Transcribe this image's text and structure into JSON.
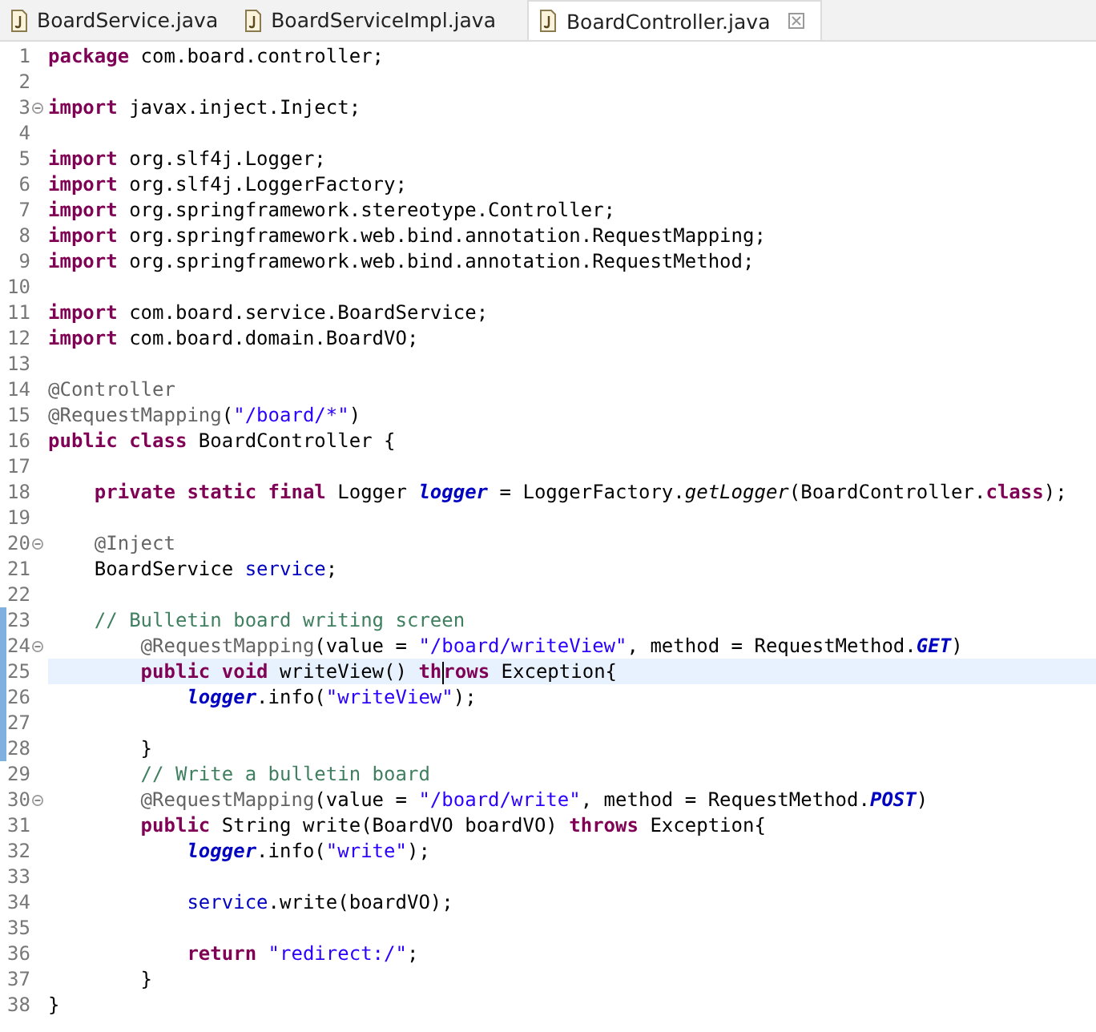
{
  "tabs": [
    {
      "label": "BoardService.java",
      "selected": false,
      "closable": false
    },
    {
      "label": "BoardServiceImpl.java",
      "selected": false,
      "closable": false
    },
    {
      "label": "BoardController.java",
      "selected": true,
      "closable": true
    }
  ],
  "editor": {
    "lines": [
      {
        "number": "1",
        "fold": false,
        "changed": false,
        "current": false,
        "tokens": [
          {
            "kind": "kw",
            "text": "package"
          },
          {
            "kind": "plain",
            "text": " com.board.controller;"
          }
        ]
      },
      {
        "number": "2",
        "fold": false,
        "changed": false,
        "current": false
      },
      {
        "number": "3",
        "fold": true,
        "changed": false,
        "current": false,
        "tokens": [
          {
            "kind": "kw",
            "text": "import"
          },
          {
            "kind": "plain",
            "text": " javax.inject.Inject;"
          }
        ]
      },
      {
        "number": "4",
        "fold": false,
        "changed": false,
        "current": false
      },
      {
        "number": "5",
        "fold": false,
        "changed": false,
        "current": false,
        "tokens": [
          {
            "kind": "kw",
            "text": "import"
          },
          {
            "kind": "plain",
            "text": " org.slf4j.Logger;"
          }
        ]
      },
      {
        "number": "6",
        "fold": false,
        "changed": false,
        "current": false,
        "tokens": [
          {
            "kind": "kw",
            "text": "import"
          },
          {
            "kind": "plain",
            "text": " org.slf4j.LoggerFactory;"
          }
        ]
      },
      {
        "number": "7",
        "fold": false,
        "changed": false,
        "current": false,
        "tokens": [
          {
            "kind": "kw",
            "text": "import"
          },
          {
            "kind": "plain",
            "text": " org.springframework.stereotype.Controller;"
          }
        ]
      },
      {
        "number": "8",
        "fold": false,
        "changed": false,
        "current": false,
        "tokens": [
          {
            "kind": "kw",
            "text": "import"
          },
          {
            "kind": "plain",
            "text": " org.springframework.web.bind.annotation.RequestMapping;"
          }
        ]
      },
      {
        "number": "9",
        "fold": false,
        "changed": false,
        "current": false,
        "tokens": [
          {
            "kind": "kw",
            "text": "import"
          },
          {
            "kind": "plain",
            "text": " org.springframework.web.bind.annotation.RequestMethod;"
          }
        ]
      },
      {
        "number": "10",
        "fold": false,
        "changed": false,
        "current": false
      },
      {
        "number": "11",
        "fold": false,
        "changed": false,
        "current": false,
        "tokens": [
          {
            "kind": "kw",
            "text": "import"
          },
          {
            "kind": "plain",
            "text": " com.board.service.BoardService;"
          }
        ]
      },
      {
        "number": "12",
        "fold": false,
        "changed": false,
        "current": false,
        "tokens": [
          {
            "kind": "kw",
            "text": "import"
          },
          {
            "kind": "plain",
            "text": " com.board.domain.BoardVO;"
          }
        ]
      },
      {
        "number": "13",
        "fold": false,
        "changed": false,
        "current": false
      },
      {
        "number": "14",
        "fold": false,
        "changed": false,
        "current": false,
        "tokens": [
          {
            "kind": "ann",
            "text": "@Controller"
          }
        ]
      },
      {
        "number": "15",
        "fold": false,
        "changed": false,
        "current": false,
        "tokens": [
          {
            "kind": "ann",
            "text": "@RequestMapping"
          },
          {
            "kind": "plain",
            "text": "("
          },
          {
            "kind": "str",
            "text": "\"/board/*\""
          },
          {
            "kind": "plain",
            "text": ")"
          }
        ]
      },
      {
        "number": "16",
        "fold": false,
        "changed": false,
        "current": false,
        "tokens": [
          {
            "kind": "kw",
            "text": "public class"
          },
          {
            "kind": "plain",
            "text": " BoardController {"
          }
        ]
      },
      {
        "number": "17",
        "fold": false,
        "changed": false,
        "current": false
      },
      {
        "number": "18",
        "fold": false,
        "changed": false,
        "current": false,
        "tokens": [
          {
            "kind": "kw",
            "text": "    private static final"
          },
          {
            "kind": "plain",
            "text": " Logger "
          },
          {
            "kind": "static",
            "text": "logger"
          },
          {
            "kind": "plain",
            "text": " = LoggerFactory."
          },
          {
            "kind": "italic",
            "text": "getLogger"
          },
          {
            "kind": "plain",
            "text": "(BoardController."
          },
          {
            "kind": "kw",
            "text": "class"
          },
          {
            "kind": "plain",
            "text": ");"
          }
        ]
      },
      {
        "number": "19",
        "fold": false,
        "changed": false,
        "current": false
      },
      {
        "number": "20",
        "fold": true,
        "changed": false,
        "current": false,
        "tokens": [
          {
            "kind": "ann",
            "text": "    @Inject"
          }
        ]
      },
      {
        "number": "21",
        "fold": false,
        "changed": false,
        "current": false,
        "tokens": [
          {
            "kind": "plain",
            "text": "    BoardService "
          },
          {
            "kind": "field",
            "text": "service"
          },
          {
            "kind": "plain",
            "text": ";"
          }
        ]
      },
      {
        "number": "22",
        "fold": false,
        "changed": false,
        "current": false
      },
      {
        "number": "23",
        "fold": false,
        "changed": true,
        "current": false,
        "tokens": [
          {
            "kind": "cmt",
            "text": "    // Bulletin board writing screen"
          }
        ]
      },
      {
        "number": "24",
        "fold": true,
        "changed": true,
        "current": false,
        "tokens": [
          {
            "kind": "ann",
            "text": "        @RequestMapping"
          },
          {
            "kind": "plain",
            "text": "(value = "
          },
          {
            "kind": "str",
            "text": "\"/board/writeView\""
          },
          {
            "kind": "plain",
            "text": ", method = RequestMethod."
          },
          {
            "kind": "static",
            "text": "GET"
          },
          {
            "kind": "plain",
            "text": ")"
          }
        ]
      },
      {
        "number": "25",
        "fold": false,
        "changed": true,
        "current": true,
        "tokens": [
          {
            "kind": "kw",
            "text": "        public void"
          },
          {
            "kind": "plain",
            "text": " writeView() "
          },
          {
            "kind": "kw",
            "text": "th",
            "caret": true
          },
          {
            "kind": "kw",
            "text": "rows"
          },
          {
            "kind": "plain",
            "text": " Exception{"
          }
        ]
      },
      {
        "number": "26",
        "fold": false,
        "changed": true,
        "current": false,
        "tokens": [
          {
            "kind": "static",
            "text": "            logger"
          },
          {
            "kind": "plain",
            "text": ".info("
          },
          {
            "kind": "str",
            "text": "\"writeView\""
          },
          {
            "kind": "plain",
            "text": ");"
          }
        ]
      },
      {
        "number": "27",
        "fold": false,
        "changed": true,
        "current": false
      },
      {
        "number": "28",
        "fold": false,
        "changed": true,
        "current": false,
        "tokens": [
          {
            "kind": "plain",
            "text": "        }"
          }
        ]
      },
      {
        "number": "29",
        "fold": false,
        "changed": false,
        "current": false,
        "tokens": [
          {
            "kind": "cmt",
            "text": "        // Write a bulletin board"
          }
        ]
      },
      {
        "number": "30",
        "fold": true,
        "changed": false,
        "current": false,
        "tokens": [
          {
            "kind": "ann",
            "text": "        @RequestMapping"
          },
          {
            "kind": "plain",
            "text": "(value = "
          },
          {
            "kind": "str",
            "text": "\"/board/write\""
          },
          {
            "kind": "plain",
            "text": ", method = RequestMethod."
          },
          {
            "kind": "static",
            "text": "POST"
          },
          {
            "kind": "plain",
            "text": ")"
          }
        ]
      },
      {
        "number": "31",
        "fold": false,
        "changed": false,
        "current": false,
        "tokens": [
          {
            "kind": "kw",
            "text": "        public"
          },
          {
            "kind": "plain",
            "text": " String write(BoardVO boardVO) "
          },
          {
            "kind": "kw",
            "text": "throws"
          },
          {
            "kind": "plain",
            "text": " Exception{"
          }
        ]
      },
      {
        "number": "32",
        "fold": false,
        "changed": false,
        "current": false,
        "tokens": [
          {
            "kind": "static",
            "text": "            logger"
          },
          {
            "kind": "plain",
            "text": ".info("
          },
          {
            "kind": "str",
            "text": "\"write\""
          },
          {
            "kind": "plain",
            "text": ");"
          }
        ]
      },
      {
        "number": "33",
        "fold": false,
        "changed": false,
        "current": false
      },
      {
        "number": "34",
        "fold": false,
        "changed": false,
        "current": false,
        "tokens": [
          {
            "kind": "field",
            "text": "            service"
          },
          {
            "kind": "plain",
            "text": ".write(boardVO);"
          }
        ]
      },
      {
        "number": "35",
        "fold": false,
        "changed": false,
        "current": false
      },
      {
        "number": "36",
        "fold": false,
        "changed": false,
        "current": false,
        "tokens": [
          {
            "kind": "kw",
            "text": "            return"
          },
          {
            "kind": "str",
            "text": " \"redirect:/\""
          },
          {
            "kind": "plain",
            "text": ";"
          }
        ]
      },
      {
        "number": "37",
        "fold": false,
        "changed": false,
        "current": false,
        "tokens": [
          {
            "kind": "plain",
            "text": "        }"
          }
        ]
      },
      {
        "number": "38",
        "fold": false,
        "changed": false,
        "current": false,
        "tokens": [
          {
            "kind": "plain",
            "text": "}"
          }
        ]
      }
    ]
  }
}
